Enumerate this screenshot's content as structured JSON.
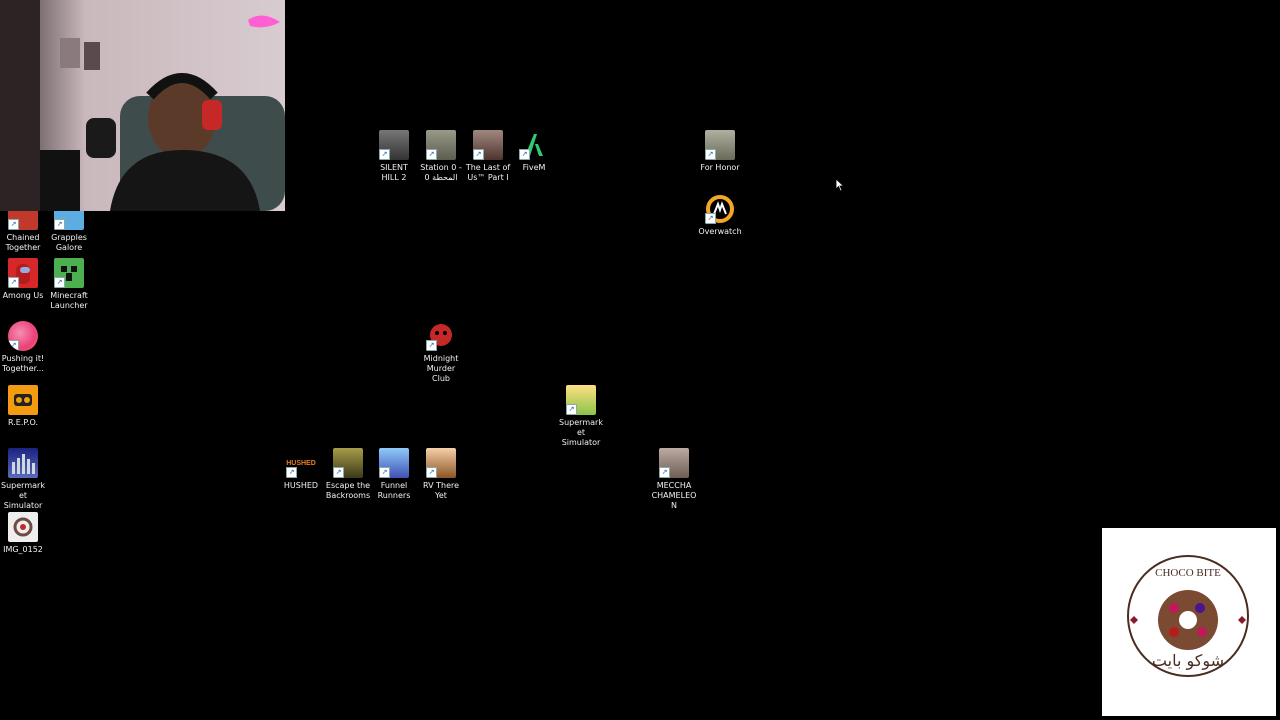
{
  "desktop": {
    "icons": [
      {
        "label": "Chained Together",
        "icon": "chained-together-icon",
        "color": "#c0392b"
      },
      {
        "label": "Grapples Galore",
        "icon": "grapples-galore-icon",
        "color": "#5dade2"
      },
      {
        "label": "Among Us",
        "icon": "among-us-icon",
        "color": "#d62828"
      },
      {
        "label": "Minecraft Launcher",
        "icon": "minecraft-icon",
        "color": "#4caf50"
      },
      {
        "label": "Pushing it! Together...",
        "icon": "pushing-it-icon",
        "color": "#ec407a"
      },
      {
        "label": "R.E.P.O.",
        "icon": "repo-icon",
        "color": "#f39c12"
      },
      {
        "label": "Supermarket Simulator",
        "icon": "supermarket-simulator-icon",
        "color": "#3f51b5"
      },
      {
        "label": "IMG_0152",
        "icon": "image-file-icon",
        "color": "#eeeeee"
      },
      {
        "label": "SILENT HILL 2",
        "icon": "silent-hill-icon",
        "color": "#555555"
      },
      {
        "label": "Station 0 - المحطة 0",
        "icon": "station-0-icon",
        "color": "#7a7a6a"
      },
      {
        "label": "The Last of Us™ Part I",
        "icon": "last-of-us-icon",
        "color": "#8d6e63"
      },
      {
        "label": "FiveM",
        "icon": "fivem-icon",
        "color": "#2ecc71"
      },
      {
        "label": "For Honor",
        "icon": "for-honor-icon",
        "color": "#9e9e8e"
      },
      {
        "label": "Overwatch",
        "icon": "overwatch-icon",
        "color": "#f5a623"
      },
      {
        "label": "Midnight Murder Club",
        "icon": "midnight-murder-club-icon",
        "color": "#b71c1c"
      },
      {
        "label": "Supermarket Simulator",
        "icon": "supermarket-simulator-2-icon",
        "color": "#f7c948"
      },
      {
        "label": "HUSHED",
        "icon": "hushed-icon",
        "color": "#e67e22"
      },
      {
        "label": "Escape the Backrooms",
        "icon": "escape-backrooms-icon",
        "color": "#6d6b2e"
      },
      {
        "label": "Funnel Runners",
        "icon": "funnel-runners-icon",
        "color": "#4a7bd1"
      },
      {
        "label": "RV There Yet",
        "icon": "rv-there-yet-icon",
        "color": "#e0a070"
      },
      {
        "label": "MECCHA CHAMELEON",
        "icon": "meccha-chameleon-icon",
        "color": "#9a8d80"
      }
    ]
  },
  "overlay": {
    "logo_text": "CHOCO BITE",
    "logo_arabic": "شوكو بايت"
  },
  "colors": {
    "background": "#000000",
    "label_text": "#f2f2f2"
  }
}
